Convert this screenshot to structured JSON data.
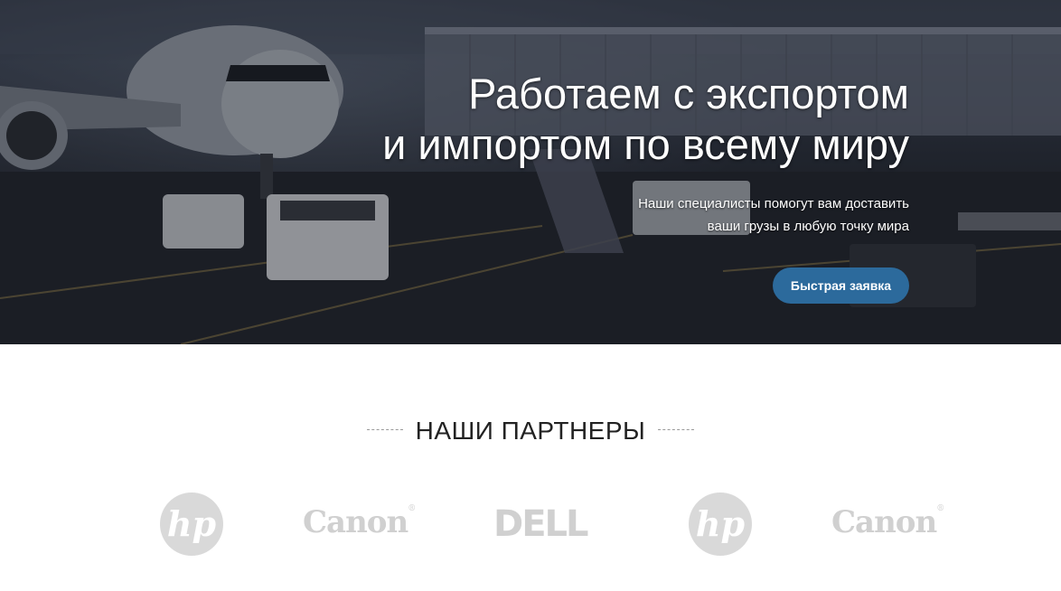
{
  "hero": {
    "title_line1": "Работаем с экспортом",
    "title_line2": "и импортом по всему миру",
    "subtitle_line1": "Наши специалисты помогут вам доставить",
    "subtitle_line2": "ваши грузы в любую точку мира",
    "cta_label": "Быстрая заявка",
    "cta_color": "#2c6a9c"
  },
  "partners": {
    "heading": "НАШИ ПАРТНЕРЫ",
    "logos": [
      {
        "name": "hp",
        "text": "hp"
      },
      {
        "name": "canon",
        "text": "Canon"
      },
      {
        "name": "dell",
        "text": "DELL"
      },
      {
        "name": "hp",
        "text": "hp"
      },
      {
        "name": "canon",
        "text": "Canon"
      }
    ]
  }
}
